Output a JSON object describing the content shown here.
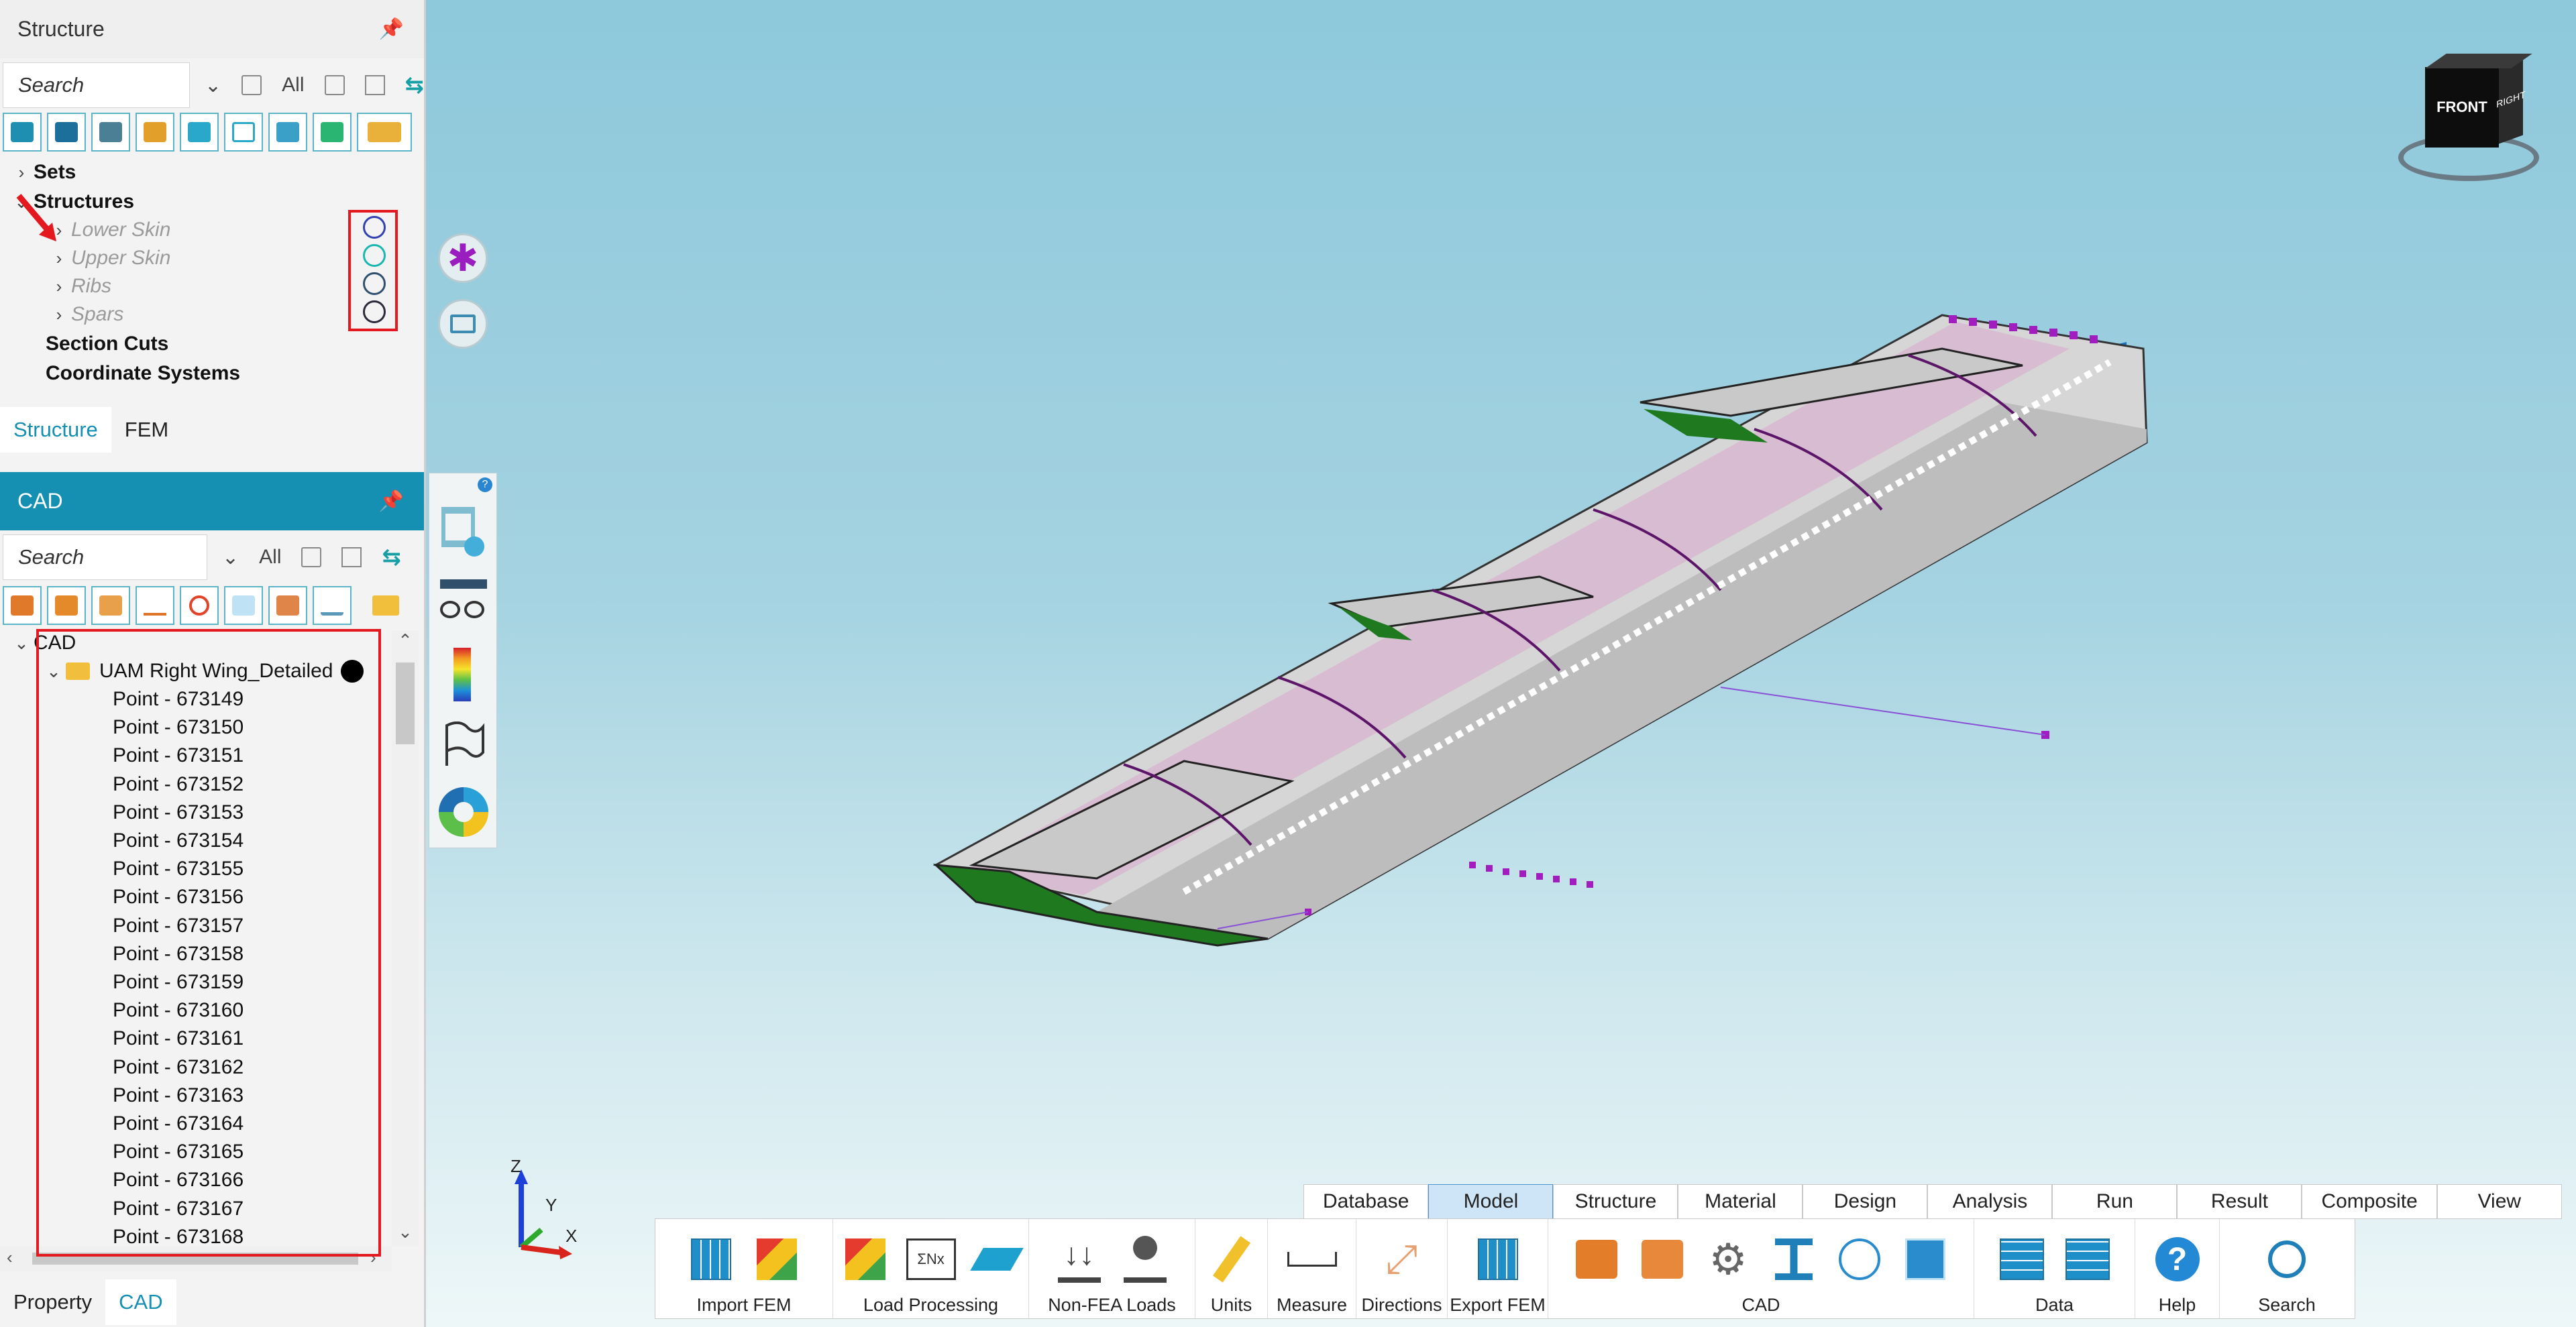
{
  "structure_panel": {
    "title": "Structure",
    "search_placeholder": "Search",
    "filter_label": "All",
    "tree": {
      "sets": "Sets",
      "structures": "Structures",
      "children": [
        "Lower Skin",
        "Upper Skin",
        "Ribs",
        "Spars"
      ],
      "child_ring_colors": [
        "#3340b0",
        "#19b7b0",
        "#2f4f6f",
        "#2a2a3a"
      ],
      "section_cuts": "Section Cuts",
      "coordinate_systems": "Coordinate Systems"
    },
    "tabs": [
      "Structure",
      "FEM"
    ]
  },
  "cad_panel": {
    "title": "CAD",
    "search_placeholder": "Search",
    "filter_label": "All",
    "root": "CAD",
    "folder": "UAM Right Wing_Detailed",
    "points": [
      "Point - 673149",
      "Point - 673150",
      "Point - 673151",
      "Point - 673152",
      "Point - 673153",
      "Point - 673154",
      "Point - 673155",
      "Point - 673156",
      "Point - 673157",
      "Point - 673158",
      "Point - 673159",
      "Point - 673160",
      "Point - 673161",
      "Point - 673162",
      "Point - 673163",
      "Point - 673164",
      "Point - 673165",
      "Point - 673166",
      "Point - 673167",
      "Point - 673168"
    ]
  },
  "bottom_tabs": [
    "Property",
    "CAD"
  ],
  "view_cube": {
    "front": "FRONT",
    "right": "RIGHT"
  },
  "axis_triad": {
    "z": "Z",
    "y": "Y",
    "x": "X"
  },
  "ribbon_tabs": [
    "Database",
    "Model",
    "Structure",
    "Material",
    "Design",
    "Analysis",
    "Run",
    "Result",
    "Composite",
    "View"
  ],
  "active_ribbon_tab": "Model",
  "ribbon_groups": [
    {
      "label": "Import FEM"
    },
    {
      "label": "Load Processing"
    },
    {
      "label": "Non-FEA Loads"
    },
    {
      "label": "Units"
    },
    {
      "label": "Measure"
    },
    {
      "label": "Directions"
    },
    {
      "label": "Export FEM"
    },
    {
      "label": "CAD"
    },
    {
      "label": "Data"
    },
    {
      "label": "Help"
    },
    {
      "label": "Search"
    }
  ],
  "colors": {
    "teal": "#1590b3",
    "highlight_red": "#e4191f",
    "wing_green": "#1f7a1f",
    "point_magenta": "#a21dbf"
  }
}
